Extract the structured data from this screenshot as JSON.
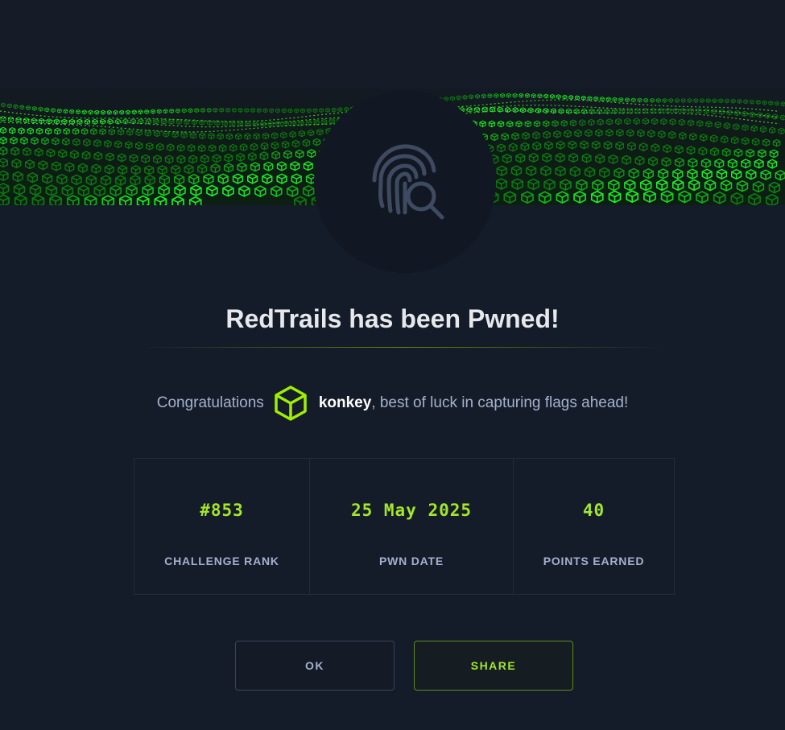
{
  "modal": {
    "title": "RedTrails has been Pwned!",
    "congrats_prefix": "Congratulations",
    "username": "konkey",
    "congrats_suffix": ", best of luck in capturing flags ahead!",
    "badge_icon": "fingerprint-search-icon",
    "user_icon": "cube-icon"
  },
  "stats": [
    {
      "value": "#853",
      "label": "CHALLENGE RANK"
    },
    {
      "value": "25 May 2025",
      "label": "PWN DATE"
    },
    {
      "value": "40",
      "label": "POINTS EARNED"
    }
  ],
  "buttons": {
    "ok_label": "OK",
    "share_label": "SHARE"
  },
  "colors": {
    "accent": "#9fef00",
    "background": "#141d2b",
    "text_muted": "#a4b1cd"
  }
}
